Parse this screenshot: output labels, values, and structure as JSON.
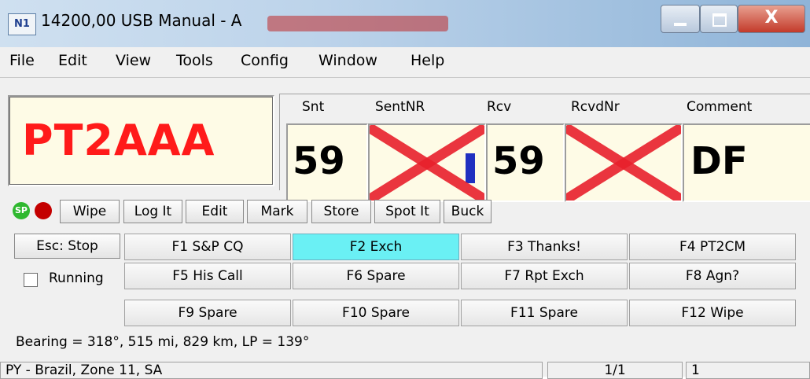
{
  "window": {
    "icon_text": "N1",
    "title": "14200,00 USB Manual - A",
    "controls": {
      "close": "X"
    }
  },
  "menu": [
    "File",
    "Edit",
    "View",
    "Tools",
    "Config",
    "Window",
    "Help"
  ],
  "entry": {
    "callsign": "PT2AAA",
    "fields": [
      {
        "label": "Snt",
        "value": "59"
      },
      {
        "label": "SentNR",
        "value": ""
      },
      {
        "label": "Rcv",
        "value": "59"
      },
      {
        "label": "RcvdNr",
        "value": ""
      },
      {
        "label": "Comment",
        "value": "DF"
      }
    ]
  },
  "indicators": {
    "sp_label": "SP",
    "sp_color": "#2fb82f",
    "rec_color": "#c40000"
  },
  "toolbar": [
    "Wipe",
    "Log It",
    "Edit",
    "Mark",
    "Store",
    "Spot It",
    "Buck"
  ],
  "esc_button": "Esc: Stop",
  "running_label": "Running",
  "fkeys": [
    [
      "F1 S&P CQ",
      "F2 Exch",
      "F3 Thanks!",
      "F4 PT2CM"
    ],
    [
      "F5 His Call",
      "F6 Spare",
      "F7 Rpt Exch",
      "F8 Agn?"
    ],
    [
      "F9 Spare",
      "F10 Spare",
      "F11 Spare",
      "F12 Wipe"
    ]
  ],
  "highlighted_fkey": "F2 Exch",
  "bearing": "Bearing = 318°, 515  mi, 829 km, LP = 139°",
  "statusbar": {
    "country": "PY - Brazil, Zone 11, SA",
    "count": "1/1",
    "extra": "1"
  }
}
